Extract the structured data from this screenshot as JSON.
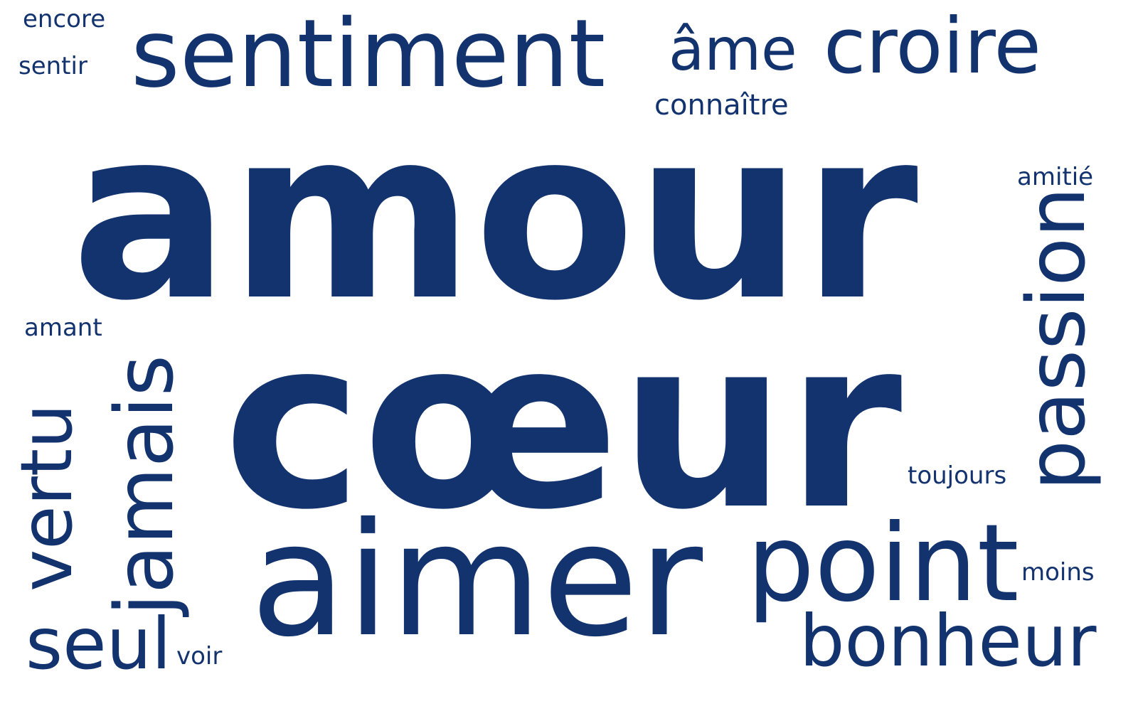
{
  "words": {
    "amour": "amour",
    "coeur": "cœur",
    "sentiment": "sentiment",
    "ame": "âme",
    "croire": "croire",
    "connaitre": "connaître",
    "amitie": "amitié",
    "encore": "encore",
    "sentir": "sentir",
    "amant": "amant",
    "toujours": "toujours",
    "moins": "moins",
    "voir": "voir",
    "aimer": "aimer",
    "point": "point",
    "bonheur": "bonheur",
    "seul": "seul",
    "passion": "passion",
    "jamais": "jamais",
    "vertu": "vertu"
  },
  "colors": {
    "text": "#13336f",
    "background": "#ffffff"
  }
}
